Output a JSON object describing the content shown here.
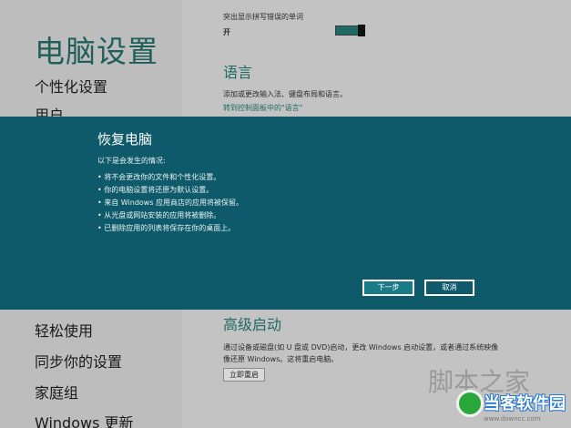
{
  "sidebar": {
    "title": "电脑设置",
    "items_top": [
      "个性化设置",
      "用户"
    ],
    "items_bottom": [
      "轻松使用",
      "同步你的设置",
      "家庭组",
      "Windows 更新"
    ]
  },
  "content": {
    "spell_label": "突出显示拼写错误的单词",
    "spell_toggle_value": "开",
    "language_heading": "语言",
    "language_desc": "添加或更改输入法、键盘布局和语言。",
    "language_link": "转到控制面板中的\"语言\"",
    "advanced_heading": "高级启动",
    "advanced_desc_1": "通过设备或磁盘(如 U 盘或 DVD)启动，更改 Windows 启动设置，或者通过系统映像",
    "advanced_desc_2": "像还原 Windows。这将重启电脑。",
    "restart_button": "立即重启"
  },
  "dialog": {
    "title": "恢复电脑",
    "subtitle": "以下是会发生的情况:",
    "bullets": [
      "将不会更改你的文件和个性化设置。",
      "你的电脑设置将还原为默认设置。",
      "来自 Windows 应用商店的应用将被保留。",
      "从光盘或网站安装的应用将被删除。",
      "已删除应用的列表将保存在你的桌面上。"
    ],
    "next_button": "下一步",
    "cancel_button": "取消"
  },
  "watermark": {
    "text1": "脚本之家",
    "text2": "当客软件园",
    "url": "www.downcc.com"
  },
  "colors": {
    "dialog_bg": "#0e5a6a",
    "accent": "#1f6a62"
  }
}
